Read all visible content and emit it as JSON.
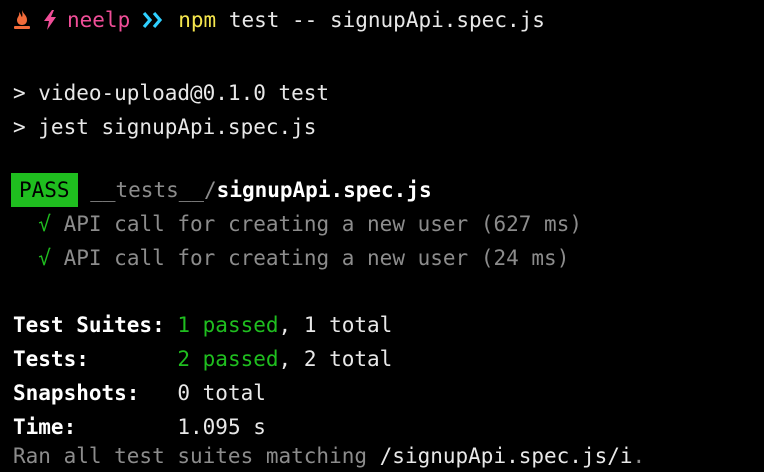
{
  "prompt": {
    "user": "neelp",
    "command": "npm",
    "args": "test -- signupApi.spec.js"
  },
  "output": {
    "script_line": "> video-upload@0.1.0 test",
    "jest_line": "> jest signupApi.spec.js"
  },
  "result": {
    "badge": "PASS",
    "path_prefix": "__tests__/",
    "file_name": "signupApi.spec.js",
    "tests": [
      {
        "check": "√",
        "name": "API call for creating a new user (627 ms)"
      },
      {
        "check": "√",
        "name": "API call for creating a new user (24 ms)"
      }
    ]
  },
  "summary": {
    "suites_label": "Test Suites: ",
    "suites_passed": "1 passed",
    "suites_total": ", 1 total",
    "tests_label": "Tests:       ",
    "tests_passed": "2 passed",
    "tests_total": ", 2 total",
    "snapshots_label": "Snapshots:   ",
    "snapshots_value": "0 total",
    "time_label": "Time:        ",
    "time_value": "1.095 s",
    "ran_prefix": "Ran all test suites matching ",
    "ran_pattern": "/signupApi.spec.js/i",
    "ran_suffix": "."
  },
  "colors": {
    "background": "#000000",
    "pass_green": "#1fbe1f",
    "prompt_user": "#f04e98",
    "prompt_command": "#f5e64d",
    "dim_text": "#8c8c8c"
  },
  "icons": [
    "flame-icon",
    "bolt-icon",
    "chevron-icon"
  ]
}
